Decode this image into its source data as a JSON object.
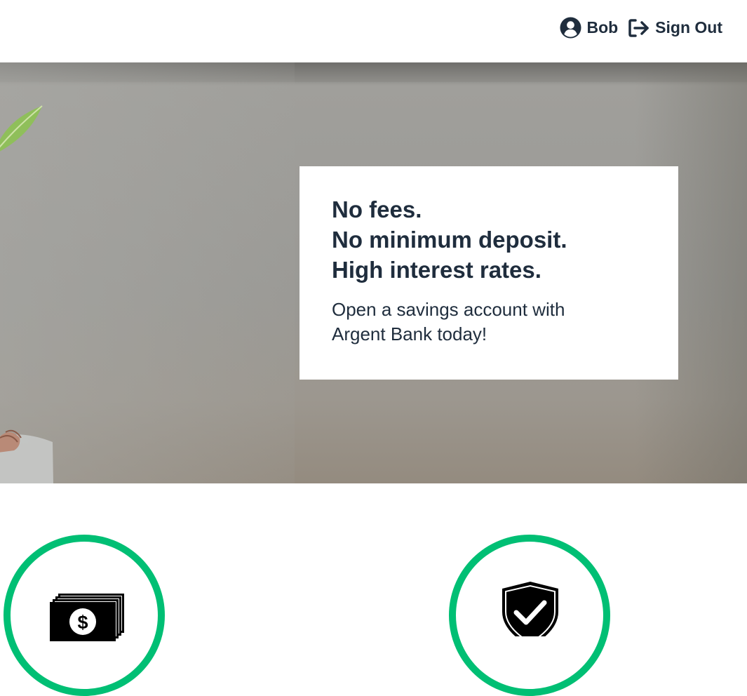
{
  "header": {
    "user_name": "Bob",
    "sign_out_label": "Sign Out"
  },
  "icons": {
    "user": "user-circle-icon",
    "sign_out": "sign-out-icon",
    "money": "money-bills-icon",
    "shield": "shield-check-icon"
  },
  "hero": {
    "headline": [
      "No fees.",
      "No minimum deposit.",
      "High interest rates."
    ],
    "subtext": "Open a savings account with Argent Bank today!"
  },
  "colors": {
    "text": "#1f2d3d",
    "accent": "#00bf74",
    "card_bg": "#ffffff"
  }
}
